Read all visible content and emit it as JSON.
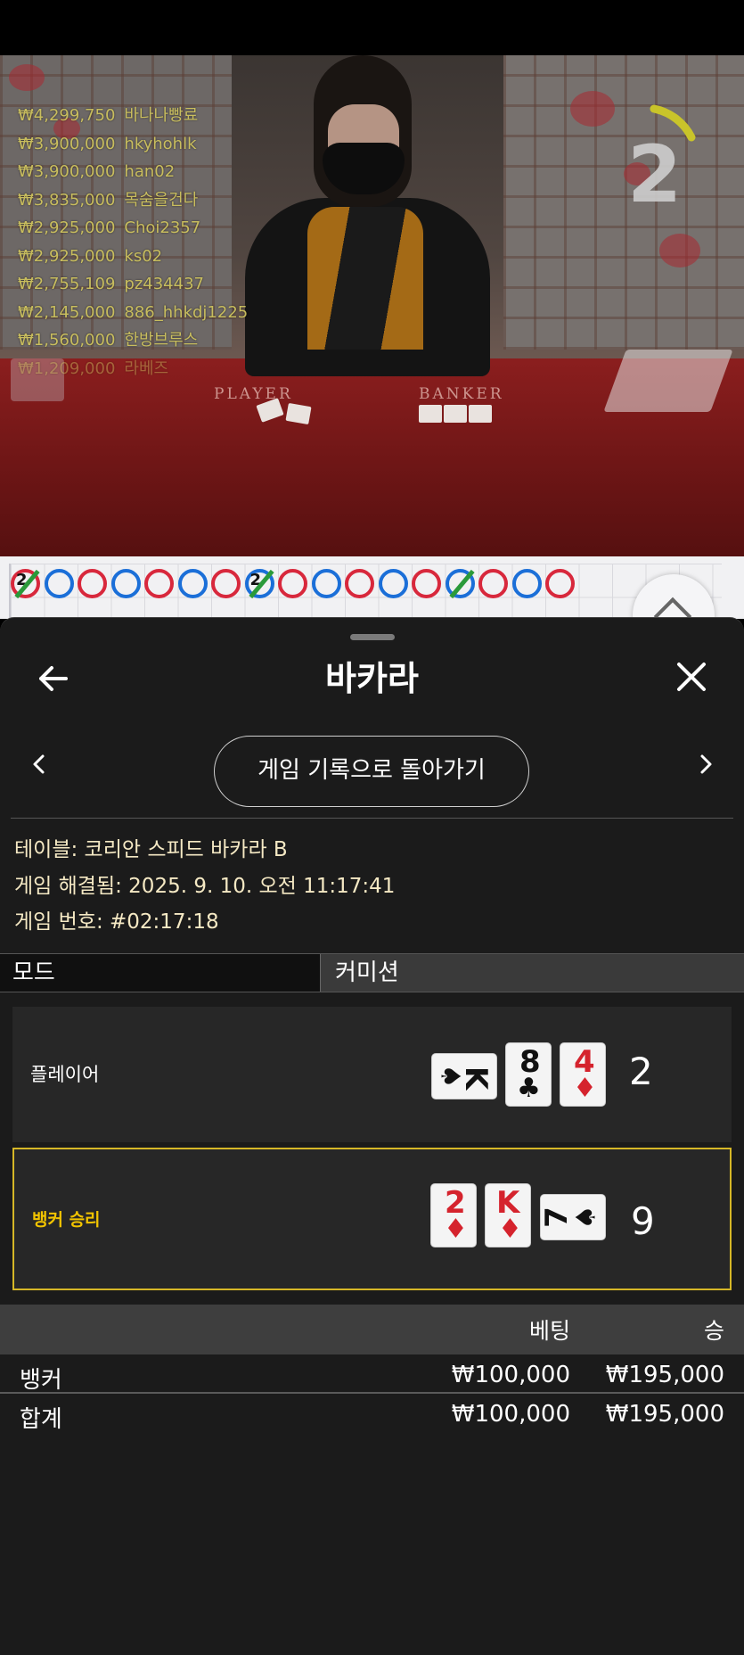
{
  "video": {
    "table_labels": {
      "player": "PLAYER",
      "banker": "BANKER"
    },
    "countdown": "2",
    "winners": [
      {
        "amount": "₩4,299,750",
        "name": "바나나빵료"
      },
      {
        "amount": "₩3,900,000",
        "name": "hkyhohlk"
      },
      {
        "amount": "₩3,900,000",
        "name": "han02"
      },
      {
        "amount": "₩3,835,000",
        "name": "목숨을건다"
      },
      {
        "amount": "₩2,925,000",
        "name": "Choi2357"
      },
      {
        "amount": "₩2,925,000",
        "name": "ks02"
      },
      {
        "amount": "₩2,755,109",
        "name": "pz434437"
      },
      {
        "amount": "₩2,145,000",
        "name": "886_hhkdj1225"
      },
      {
        "amount": "₩1,560,000",
        "name": "한방브루스"
      },
      {
        "amount": "₩1,209,000",
        "name": "라베즈"
      }
    ]
  },
  "roadmap": {
    "row1": [
      "B2",
      "P",
      "B",
      "P",
      "B",
      "P",
      "B",
      "P2",
      "B",
      "P",
      "B",
      "P",
      "B",
      "T",
      "B",
      "P",
      "B"
    ],
    "colors": {
      "player": "#1b6fd8",
      "banker": "#d8283c",
      "tie": "#2a9a3a"
    }
  },
  "sheet": {
    "title": "바카라",
    "history_button": "게임 기록으로 돌아가기",
    "info": {
      "table": "테이블: 코리안 스피드 바카라 B",
      "resolved": "게임 해결됨: 2025. 9. 10. 오전 11:17:41",
      "game_number": "게임 번호: #02:17:18"
    },
    "tabs": {
      "mode": "모드",
      "commission": "커미션"
    },
    "player": {
      "label": "플레이어",
      "score": "2",
      "cards": [
        {
          "rank": "K",
          "suit": "♠",
          "orientation": "sideways"
        },
        {
          "rank": "8",
          "suit": "♣",
          "orientation": "upright"
        },
        {
          "rank": "4",
          "suit": "♦",
          "orientation": "upright"
        }
      ]
    },
    "banker": {
      "label": "뱅커 승리",
      "score": "9",
      "cards": [
        {
          "rank": "2",
          "suit": "♦",
          "orientation": "upright"
        },
        {
          "rank": "K",
          "suit": "♦",
          "orientation": "upright"
        },
        {
          "rank": "7",
          "suit": "♠",
          "orientation": "sideways"
        }
      ]
    },
    "bets": {
      "headers": {
        "bet": "베팅",
        "win": "승"
      },
      "rows": [
        {
          "name": "뱅커",
          "bet": "₩100,000",
          "win": "₩195,000"
        },
        {
          "name": "합계",
          "bet": "₩100,000",
          "win": "₩195,000"
        }
      ]
    },
    "accent": "#d6b727"
  }
}
